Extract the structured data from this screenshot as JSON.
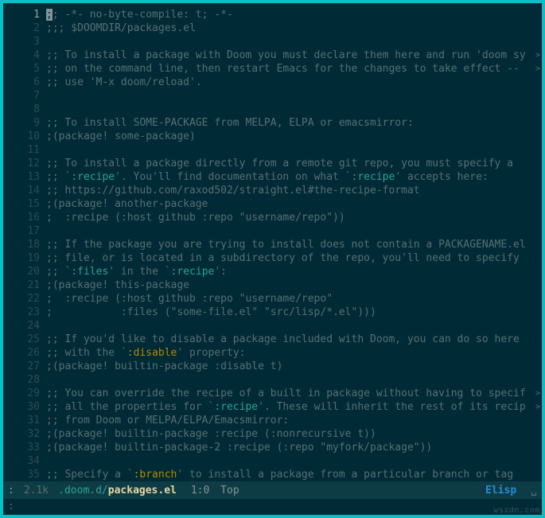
{
  "editor": {
    "lines": [
      {
        "n": 1,
        "current": true,
        "segments": [
          {
            "t": ";",
            "cls": "cursor-block"
          },
          {
            "t": "; -*- no-byte-compile: t; -*-"
          }
        ]
      },
      {
        "n": 2,
        "segments": [
          {
            "t": ";;; $DOOMDIR/packages.el"
          }
        ]
      },
      {
        "n": 3,
        "segments": []
      },
      {
        "n": 4,
        "segments": [
          {
            "t": ";; To install a package with Doom you must declare them here and run 'doom sy"
          }
        ],
        "trunc": true
      },
      {
        "n": 5,
        "segments": [
          {
            "t": ";; on the command line, then restart Emacs for the changes to take effect -- "
          }
        ],
        "trunc": true
      },
      {
        "n": 6,
        "segments": [
          {
            "t": ";; use 'M-x doom/reload'."
          }
        ]
      },
      {
        "n": 7,
        "segments": []
      },
      {
        "n": 8,
        "segments": []
      },
      {
        "n": 9,
        "segments": [
          {
            "t": ";; To install SOME-PACKAGE from MELPA, ELPA or emacsmirror:"
          }
        ]
      },
      {
        "n": 10,
        "segments": [
          {
            "t": ";(package! some-package)"
          }
        ]
      },
      {
        "n": 11,
        "segments": []
      },
      {
        "n": 12,
        "segments": [
          {
            "t": ";; To install a package directly from a remote git repo, you must specify a"
          }
        ]
      },
      {
        "n": 13,
        "segments": [
          {
            "t": ";; `"
          },
          {
            "t": ":recipe",
            "cls": "c-recipe"
          },
          {
            "t": "'. You'll find documentation on what `"
          },
          {
            "t": ":recipe",
            "cls": "c-recipe"
          },
          {
            "t": "' accepts here:"
          }
        ]
      },
      {
        "n": 14,
        "segments": [
          {
            "t": ";; https://github.com/raxod502/straight.el#the-recipe-format"
          }
        ]
      },
      {
        "n": 15,
        "segments": [
          {
            "t": ";(package! another-package"
          }
        ]
      },
      {
        "n": 16,
        "segments": [
          {
            "t": ";  :recipe (:host github :repo \"username/repo\"))"
          }
        ]
      },
      {
        "n": 17,
        "segments": []
      },
      {
        "n": 18,
        "segments": [
          {
            "t": ";; If the package you are trying to install does not contain a PACKAGENAME.el"
          }
        ]
      },
      {
        "n": 19,
        "segments": [
          {
            "t": ";; file, or is located in a subdirectory of the repo, you'll need to specify"
          }
        ]
      },
      {
        "n": 20,
        "segments": [
          {
            "t": ";; `"
          },
          {
            "t": ":files",
            "cls": "c-recipe"
          },
          {
            "t": "' in the `"
          },
          {
            "t": ":recipe",
            "cls": "c-recipe"
          },
          {
            "t": "':"
          }
        ]
      },
      {
        "n": 21,
        "segments": [
          {
            "t": ";(package! this-package"
          }
        ]
      },
      {
        "n": 22,
        "segments": [
          {
            "t": ";  :recipe (:host github :repo \"username/repo\""
          }
        ]
      },
      {
        "n": 23,
        "segments": [
          {
            "t": ";           :files (\"some-file.el\" \"src/lisp/*.el\")))"
          }
        ]
      },
      {
        "n": 24,
        "segments": []
      },
      {
        "n": 25,
        "segments": [
          {
            "t": ";; If you'd like to disable a package included with Doom, you can do so here"
          }
        ]
      },
      {
        "n": 26,
        "segments": [
          {
            "t": ";; with the `"
          },
          {
            "t": ":disable",
            "cls": "c-keyword"
          },
          {
            "t": "' property:"
          }
        ]
      },
      {
        "n": 27,
        "segments": [
          {
            "t": ";(package! builtin-package :disable t)"
          }
        ]
      },
      {
        "n": 28,
        "segments": []
      },
      {
        "n": 29,
        "segments": [
          {
            "t": ";; You can override the recipe of a built in package without having to specif"
          }
        ],
        "trunc": true
      },
      {
        "n": 30,
        "segments": [
          {
            "t": ";; all the properties for `"
          },
          {
            "t": ":recipe",
            "cls": "c-recipe"
          },
          {
            "t": "'. These will inherit the rest of its recip"
          }
        ],
        "trunc": true
      },
      {
        "n": 31,
        "segments": [
          {
            "t": ";; from Doom or MELPA/ELPA/Emacsmirror:"
          }
        ]
      },
      {
        "n": 32,
        "segments": [
          {
            "t": ";(package! builtin-package :recipe (:nonrecursive t))"
          }
        ]
      },
      {
        "n": 33,
        "segments": [
          {
            "t": ";(package! builtin-package-2 :recipe (:repo \"myfork/package\"))"
          }
        ]
      },
      {
        "n": 34,
        "segments": []
      },
      {
        "n": 35,
        "segments": [
          {
            "t": ";; Specify a `"
          },
          {
            "t": ":branch",
            "cls": "c-keyword"
          },
          {
            "t": "' to install a package from a particular branch or tag"
          }
        ]
      }
    ]
  },
  "modeline": {
    "prefix": ":",
    "size": "2.1k",
    "path": ".doom.d/",
    "file": "packages.el",
    "position": "1:0",
    "scroll": "Top",
    "mode": "Elisp",
    "encoding": "␣"
  },
  "echo": ":",
  "watermark": "wsxdn.com"
}
